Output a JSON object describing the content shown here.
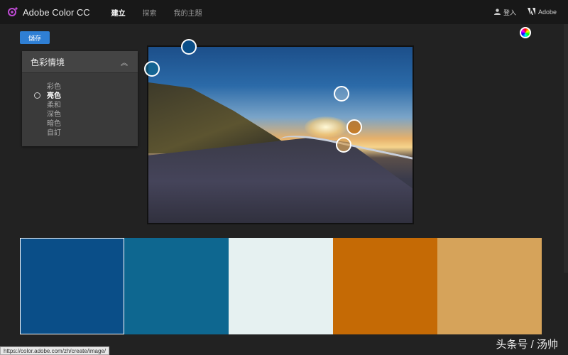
{
  "app": {
    "title": "Adobe Color CC"
  },
  "nav": {
    "tabs": [
      {
        "label": "建立",
        "active": true
      },
      {
        "label": "探索",
        "active": false
      },
      {
        "label": "我的主題",
        "active": false
      }
    ]
  },
  "header": {
    "signin_label": "登入",
    "adobe_label": "Adobe"
  },
  "toolbar": {
    "save_label": "儲存"
  },
  "mood_panel": {
    "title": "色彩情境",
    "options": [
      "彩色",
      "亮色",
      "柔和",
      "深色",
      "暗色",
      "自訂"
    ],
    "selected": "亮色"
  },
  "palette": {
    "colors": [
      "#0A4E88",
      "#0E6790",
      "#E6F1F1",
      "#C56A05",
      "#D6A35A"
    ],
    "selected_index": 0
  },
  "status": {
    "url": "https://color.adobe.com/zh/create/image/"
  },
  "watermark": "头条号 / 汤帅",
  "accent": "#2F7FD4"
}
